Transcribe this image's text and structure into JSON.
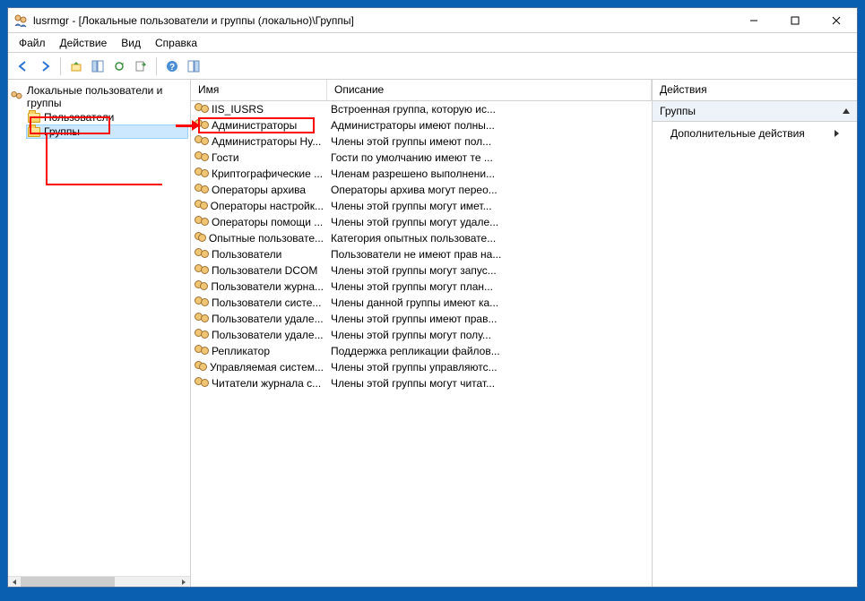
{
  "title": "lusrmgr - [Локальные пользователи и группы (локально)\\Группы]",
  "menu": {
    "file": "Файл",
    "action": "Действие",
    "view": "Вид",
    "help": "Справка"
  },
  "tree": {
    "root": "Локальные пользователи и группы",
    "users": "Пользователи",
    "groups": "Группы"
  },
  "columns": {
    "name": "Имя",
    "description": "Описание"
  },
  "groups": [
    {
      "name": "IIS_IUSRS",
      "desc": "Встроенная группа, которую ис..."
    },
    {
      "name": "Администраторы",
      "desc": "Администраторы имеют полны..."
    },
    {
      "name": "Администраторы Hy...",
      "desc": "Члены этой группы имеют пол..."
    },
    {
      "name": "Гости",
      "desc": "Гости по умолчанию имеют те ..."
    },
    {
      "name": "Криптографические ...",
      "desc": "Членам разрешено выполнени..."
    },
    {
      "name": "Операторы архива",
      "desc": "Операторы архива могут перео..."
    },
    {
      "name": "Операторы настройк...",
      "desc": "Члены этой группы могут имет..."
    },
    {
      "name": "Операторы помощи ...",
      "desc": "Члены этой группы могут удале..."
    },
    {
      "name": "Опытные пользовате...",
      "desc": "Категория опытных пользовате..."
    },
    {
      "name": "Пользователи",
      "desc": "Пользователи не имеют прав на..."
    },
    {
      "name": "Пользователи DCOM",
      "desc": "Члены этой группы могут запус..."
    },
    {
      "name": "Пользователи журна...",
      "desc": "Члены этой группы могут план..."
    },
    {
      "name": "Пользователи систе...",
      "desc": "Члены данной группы имеют ка..."
    },
    {
      "name": "Пользователи удале...",
      "desc": "Члены этой группы имеют прав..."
    },
    {
      "name": "Пользователи удале...",
      "desc": "Члены этой группы могут полу..."
    },
    {
      "name": "Репликатор",
      "desc": "Поддержка репликации файлов..."
    },
    {
      "name": "Управляемая систем...",
      "desc": "Члены этой группы управляютс..."
    },
    {
      "name": "Читатели журнала с...",
      "desc": "Члены этой группы могут читат..."
    }
  ],
  "actions": {
    "title": "Действия",
    "section": "Группы",
    "more": "Дополнительные действия"
  }
}
